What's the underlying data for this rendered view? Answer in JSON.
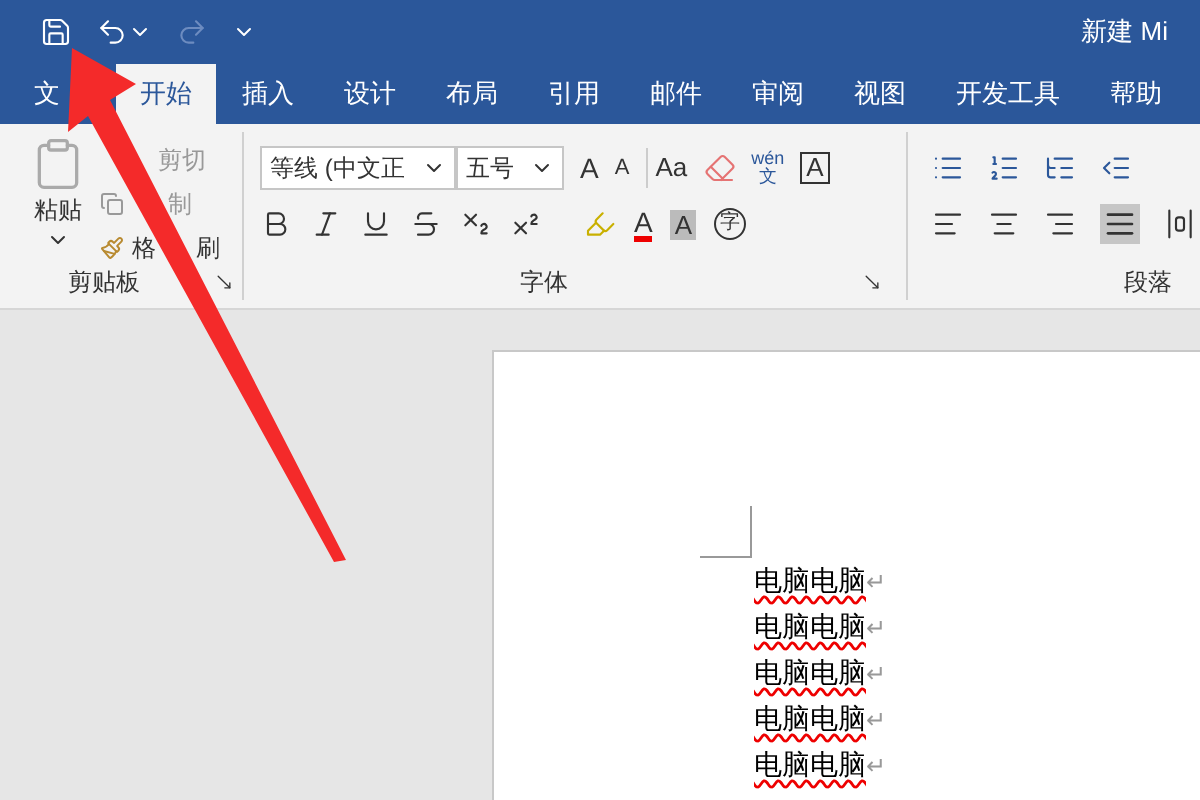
{
  "window": {
    "title": "新建 Mi"
  },
  "tabs": [
    {
      "label": "文",
      "selected": false
    },
    {
      "label": "开始",
      "selected": true
    },
    {
      "label": "插入",
      "selected": false
    },
    {
      "label": "设计",
      "selected": false
    },
    {
      "label": "布局",
      "selected": false
    },
    {
      "label": "引用",
      "selected": false
    },
    {
      "label": "邮件",
      "selected": false
    },
    {
      "label": "审阅",
      "selected": false
    },
    {
      "label": "视图",
      "selected": false
    },
    {
      "label": "开发工具",
      "selected": false
    },
    {
      "label": "帮助",
      "selected": false
    }
  ],
  "clipboard": {
    "paste": "粘贴",
    "cut": "剪切",
    "copy": "制",
    "format_painter": [
      "格",
      "刷"
    ],
    "group_label": "剪贴板"
  },
  "font": {
    "name": "等线 (中文正",
    "size": "五号",
    "grow": "A",
    "shrink": "A",
    "change_case": "Aa",
    "phonetic_top": "wén",
    "phonetic_bottom": "文",
    "border": "A",
    "font_color": "A",
    "shading": "A",
    "enclose": "字",
    "group_label": "字体"
  },
  "paragraph": {
    "group_label": "段落"
  },
  "document": {
    "lines": [
      {
        "text": "电脑电脑",
        "mark": "↵"
      },
      {
        "text": "电脑电脑",
        "mark": "↵"
      },
      {
        "text": "电脑电脑",
        "mark": "↵"
      },
      {
        "text": "电脑电脑",
        "mark": "↵"
      },
      {
        "text": "电脑电脑",
        "mark": "↵"
      }
    ]
  }
}
